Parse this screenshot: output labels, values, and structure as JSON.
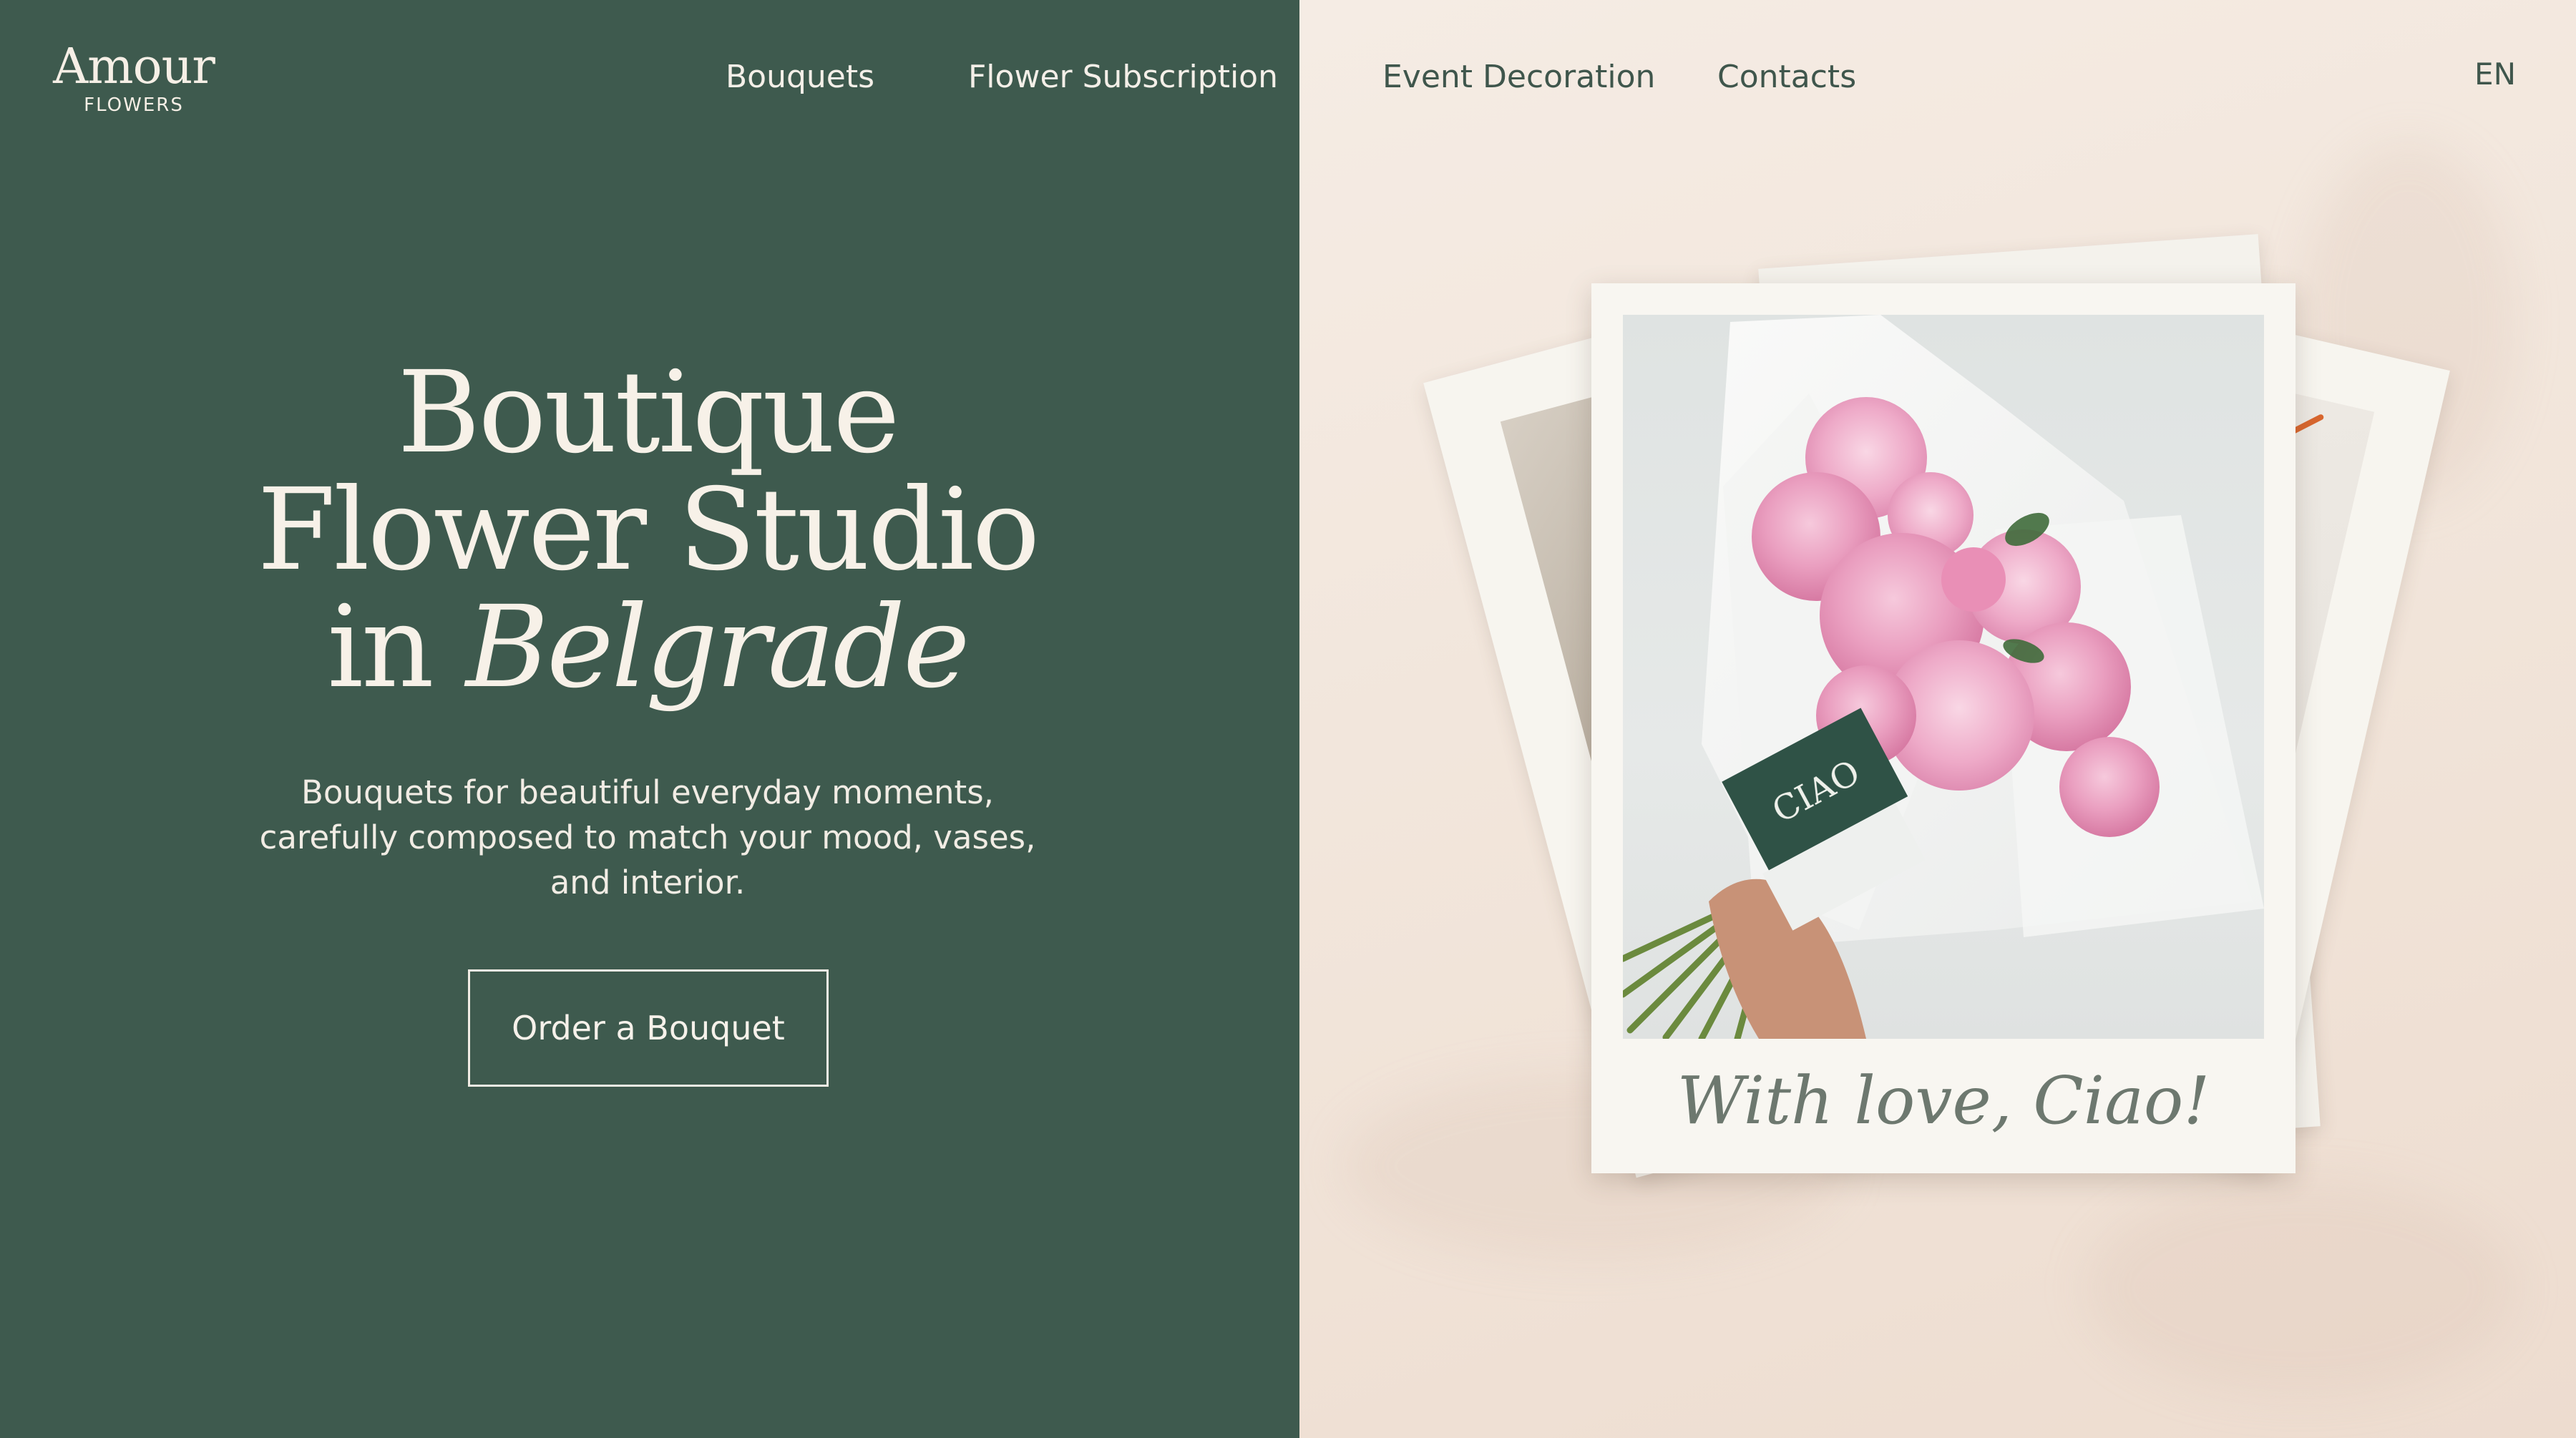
{
  "logo": {
    "name": "Amour",
    "tagline": "FLOWERS"
  },
  "nav": {
    "items": [
      {
        "label": "Bouquets"
      },
      {
        "label": "Flower Subscription"
      },
      {
        "label": "Event Decoration"
      },
      {
        "label": "Contacts"
      }
    ],
    "language": "EN"
  },
  "hero": {
    "title_line1": "Boutique",
    "title_line2": "Flower Studio",
    "title_line3_prefix": "in ",
    "title_line3_italic": "Belgrade",
    "subtitle": "Bouquets for beautiful everyday moments, carefully composed to match your mood, vases, and interior.",
    "cta_label": "Order a Bouquet"
  },
  "polaroid": {
    "caption": "With love, Ciao!",
    "card_label": "CIAO"
  },
  "colors": {
    "green_panel": "#3e5a4e",
    "cream_panel": "#f3e8df",
    "text_light": "#f7f1e8",
    "text_dark": "#3f564c"
  }
}
